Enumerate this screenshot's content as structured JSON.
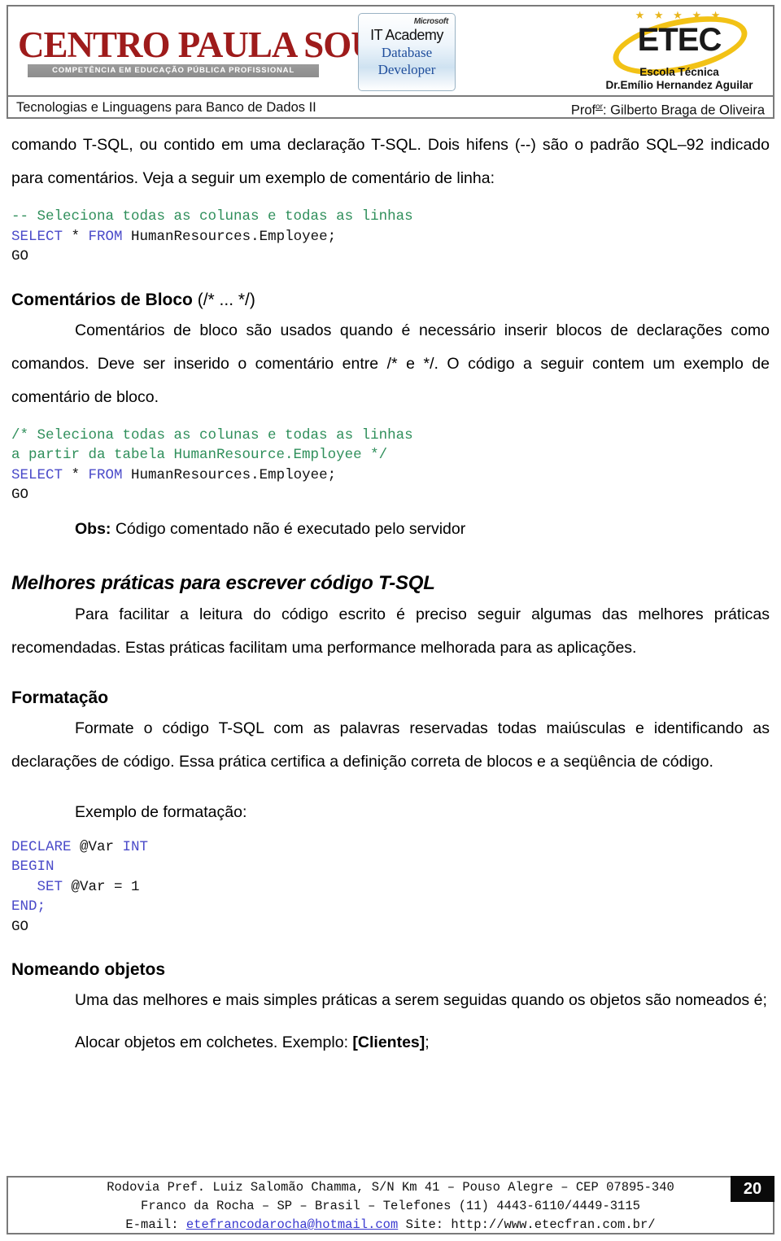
{
  "header": {
    "logo_cps": {
      "wordmark": "Centro Paula Souza",
      "tagline": "COMPETÊNCIA EM EDUCAÇÃO PÚBLICA PROFISSIONAL",
      "color": "#9e1b1b"
    },
    "badge_ms": {
      "brand": "Microsoft",
      "line1": "IT Academy",
      "line2": "Database",
      "line3": "Developer",
      "accent": "#1f4e9c"
    },
    "logo_etec": {
      "stars": "★ ★ ★ ★ ★",
      "wordmark": "ETEC",
      "sub1": "Escola Técnica",
      "sub2": "Dr.Emílio Hernandez Aguilar",
      "ring_color": "#f2c216"
    },
    "course": "Tecnologias e Linguagens para Banco de Dados II",
    "professor_prefix": "Prof",
    "professor_sup": "or",
    "professor_name": ": Gilberto Braga de Oliveira"
  },
  "body": {
    "para_intro": "comando T-SQL, ou contido em uma declaração T-SQL. Dois hifens (--) são o padrão SQL–92 indicado para comentários. Veja a seguir um exemplo de comentário de linha:",
    "code_line_comment": {
      "l1_comment": "-- Seleciona todas as colunas e todas as linhas",
      "l2_kw1": "SELECT",
      "l2_star": " * ",
      "l2_kw2": "FROM",
      "l2_rest": " HumanResources.Employee;",
      "l3_go": "GO"
    },
    "heading_block_comments_bold": "Comentários de Bloco",
    "heading_block_comments_light": " (/* ... */)",
    "para_block": "Comentários de bloco são usados quando é necessário inserir blocos de declarações como comandos. Deve ser inserido o comentário entre /* e */. O código a seguir contem um exemplo de comentário de bloco.",
    "code_block_comment": {
      "l1_comment": "/* Seleciona todas as colunas e todas as linhas",
      "l2_comment": "a partir da tabela HumanResource.Employee */",
      "l3_kw1": "SELECT",
      "l3_star": " * ",
      "l3_kw2": "FROM",
      "l3_rest": " HumanResources.Employee;",
      "l4_go": "GO"
    },
    "obs_label": "Obs:",
    "obs_text": " Código comentado não é executado pelo servidor",
    "heading_best_practices": "Melhores práticas para escrever código T-SQL",
    "para_best_practices": "Para facilitar a leitura do código escrito é preciso seguir algumas das melhores práticas recomendadas.  Estas práticas facilitam uma performance melhorada para as aplicações.",
    "heading_formatting": "Formatação",
    "para_formatting": "Formate o código T-SQL com as palavras reservadas todas maiúsculas e identificando as declarações de código. Essa prática certifica a definição correta de blocos e a seqüência de código.",
    "example_formatting_label": "Exemplo de formatação:",
    "code_formatting": {
      "l1_kw": "DECLARE",
      "l1_var": " @Var ",
      "l1_type": "INT",
      "l2_kw": "BEGIN",
      "l3_indent": "   ",
      "l3_kw": "SET",
      "l3_rest": " @Var = 1",
      "l4_kw": "END;",
      "l5_go": "GO"
    },
    "heading_naming": "Nomeando objetos",
    "para_naming": "Uma das melhores e mais simples práticas a serem seguidas quando os objetos são nomeados é;",
    "naming_example_prefix": "Alocar objetos em colchetes. Exemplo: ",
    "naming_example_bold": "[Clientes]",
    "naming_example_suffix": ";"
  },
  "footer": {
    "line1": "Rodovia Pref. Luiz Salomão Chamma, S/N Km 41 – Pouso Alegre – CEP 07895-340",
    "line2": "Franco da Rocha – SP – Brasil – Telefones (11) 4443-6110/4449-3115",
    "line3_prefix": "E-mail: ",
    "email": "etefrancodarocha@hotmail.com",
    "line3_suffix": " Site: http://www.etecfran.com.br/",
    "page_number": "20",
    "link_color": "#3a3ad0"
  }
}
